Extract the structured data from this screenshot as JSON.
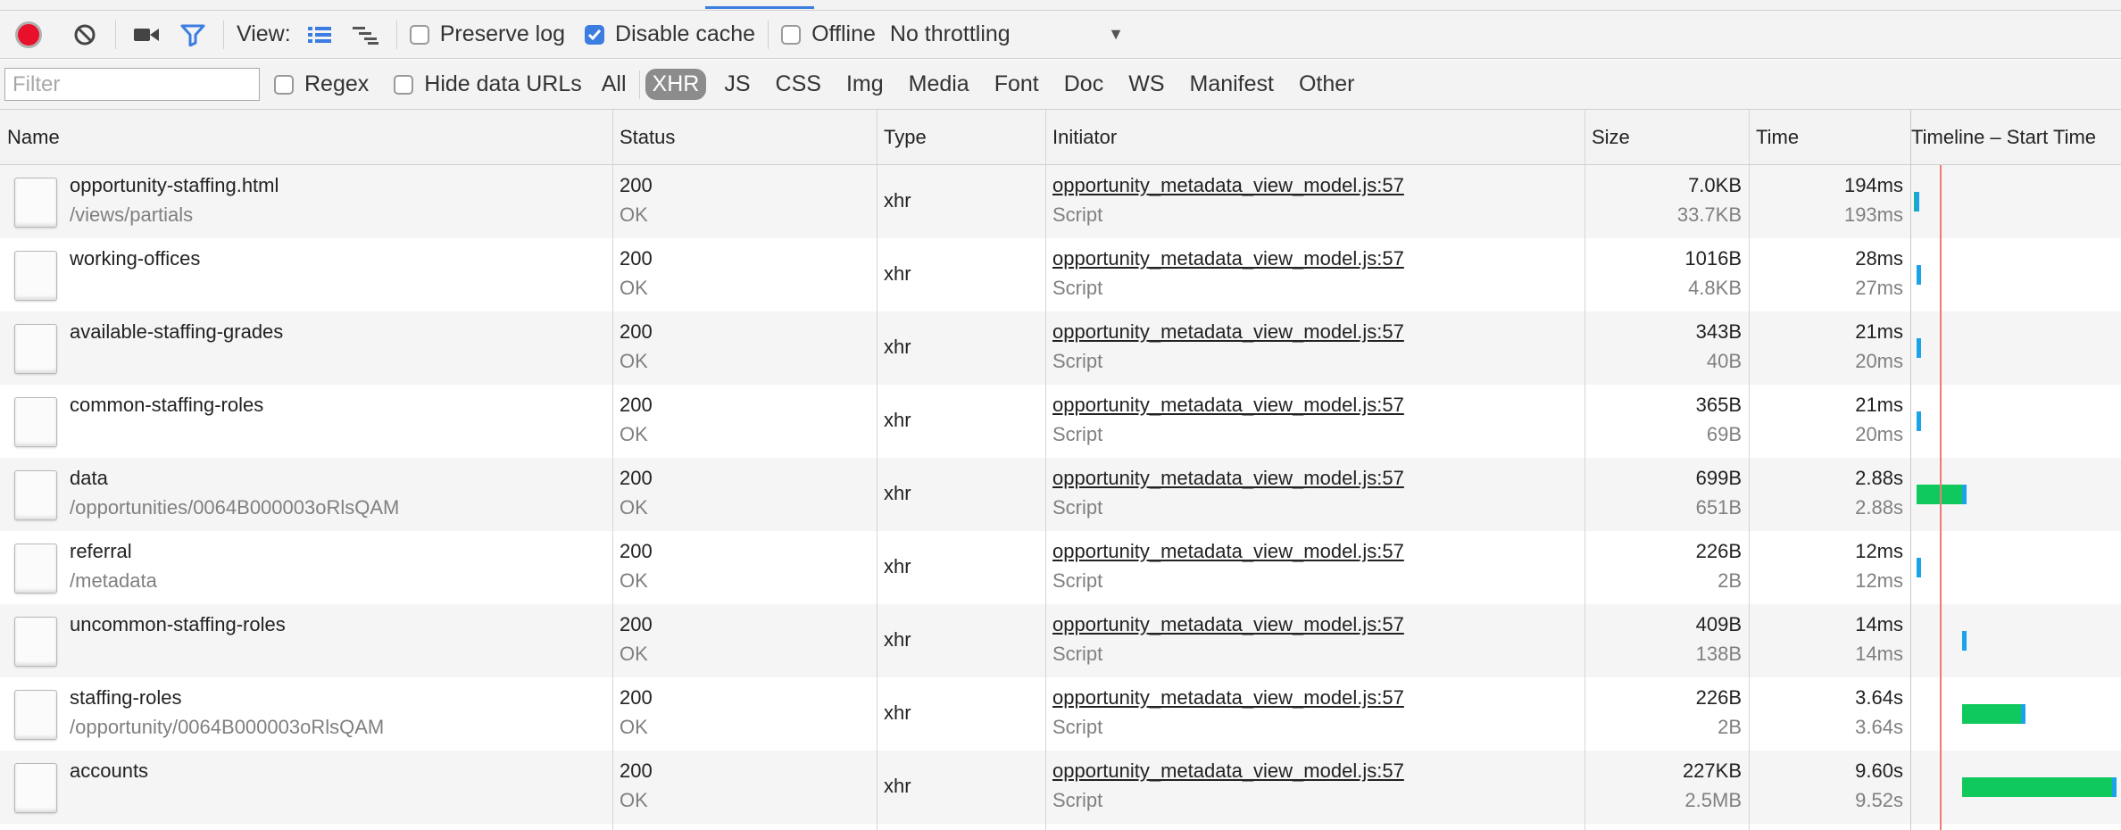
{
  "toolbar": {
    "view_label": "View:",
    "preserve_log": {
      "label": "Preserve log",
      "checked": false
    },
    "disable_cache": {
      "label": "Disable cache",
      "checked": true
    },
    "offline": {
      "label": "Offline",
      "checked": false
    },
    "throttling": "No throttling"
  },
  "filterbar": {
    "filter_placeholder": "Filter",
    "regex_label": "Regex",
    "hide_data_urls_label": "Hide data URLs",
    "types": [
      "All",
      "XHR",
      "JS",
      "CSS",
      "Img",
      "Media",
      "Font",
      "Doc",
      "WS",
      "Manifest",
      "Other"
    ],
    "active_type": "XHR"
  },
  "columns": {
    "name": "Name",
    "status": "Status",
    "type": "Type",
    "initiator": "Initiator",
    "size": "Size",
    "time": "Time",
    "timeline": "Timeline – Start Time"
  },
  "colors": {
    "waiting": "#0fc95d",
    "download": "#1aa3e8",
    "record": "#e8102a",
    "accent": "#3b7de0"
  },
  "rows": [
    {
      "name": "opportunity-staffing.html",
      "path": "/views/partials",
      "status": "200",
      "status_text": "OK",
      "type": "xhr",
      "initiator": "opportunity_metadata_view_model.js:57",
      "initiator_type": "Script",
      "size": "7.0KB",
      "content": "33.7KB",
      "time": "194ms",
      "latency": "193ms",
      "timeline": {
        "start": 0.01,
        "wait": 0.004,
        "download": 0.02
      }
    },
    {
      "name": "working-offices",
      "path": "",
      "status": "200",
      "status_text": "OK",
      "type": "xhr",
      "initiator": "opportunity_metadata_view_model.js:57",
      "initiator_type": "Script",
      "size": "1016B",
      "content": "4.8KB",
      "time": "28ms",
      "latency": "27ms",
      "timeline": {
        "start": 0.02,
        "wait": 0.0,
        "download": 0.018
      }
    },
    {
      "name": "available-staffing-grades",
      "path": "",
      "status": "200",
      "status_text": "OK",
      "type": "xhr",
      "initiator": "opportunity_metadata_view_model.js:57",
      "initiator_type": "Script",
      "size": "343B",
      "content": "40B",
      "time": "21ms",
      "latency": "20ms",
      "timeline": {
        "start": 0.02,
        "wait": 0.0,
        "download": 0.018
      }
    },
    {
      "name": "common-staffing-roles",
      "path": "",
      "status": "200",
      "status_text": "OK",
      "type": "xhr",
      "initiator": "opportunity_metadata_view_model.js:57",
      "initiator_type": "Script",
      "size": "365B",
      "content": "69B",
      "time": "21ms",
      "latency": "20ms",
      "timeline": {
        "start": 0.02,
        "wait": 0.0,
        "download": 0.018
      }
    },
    {
      "name": "data",
      "path": "/opportunities/0064B000003oRlsQAM",
      "status": "200",
      "status_text": "OK",
      "type": "xhr",
      "initiator": "opportunity_metadata_view_model.js:57",
      "initiator_type": "Script",
      "size": "699B",
      "content": "651B",
      "time": "2.88s",
      "latency": "2.88s",
      "timeline": {
        "start": 0.02,
        "wait": 0.22,
        "download": 0.025
      }
    },
    {
      "name": "referral",
      "path": "/metadata",
      "status": "200",
      "status_text": "OK",
      "type": "xhr",
      "initiator": "opportunity_metadata_view_model.js:57",
      "initiator_type": "Script",
      "size": "226B",
      "content": "2B",
      "time": "12ms",
      "latency": "12ms",
      "timeline": {
        "start": 0.02,
        "wait": 0.0,
        "download": 0.018
      }
    },
    {
      "name": "uncommon-staffing-roles",
      "path": "",
      "status": "200",
      "status_text": "OK",
      "type": "xhr",
      "initiator": "opportunity_metadata_view_model.js:57",
      "initiator_type": "Script",
      "size": "409B",
      "content": "138B",
      "time": "14ms",
      "latency": "14ms",
      "timeline": {
        "start": 0.24,
        "wait": 0.0,
        "download": 0.018
      }
    },
    {
      "name": "staffing-roles",
      "path": "/opportunity/0064B000003oRlsQAM",
      "status": "200",
      "status_text": "OK",
      "type": "xhr",
      "initiator": "opportunity_metadata_view_model.js:57",
      "initiator_type": "Script",
      "size": "226B",
      "content": "2B",
      "time": "3.64s",
      "latency": "3.64s",
      "timeline": {
        "start": 0.24,
        "wait": 0.28,
        "download": 0.015
      }
    },
    {
      "name": "accounts",
      "path": "",
      "status": "200",
      "status_text": "OK",
      "type": "xhr",
      "initiator": "opportunity_metadata_view_model.js:57",
      "initiator_type": "Script",
      "size": "227KB",
      "content": "2.5MB",
      "time": "9.60s",
      "latency": "9.52s",
      "timeline": {
        "start": 0.24,
        "wait": 0.72,
        "download": 0.015
      }
    }
  ]
}
